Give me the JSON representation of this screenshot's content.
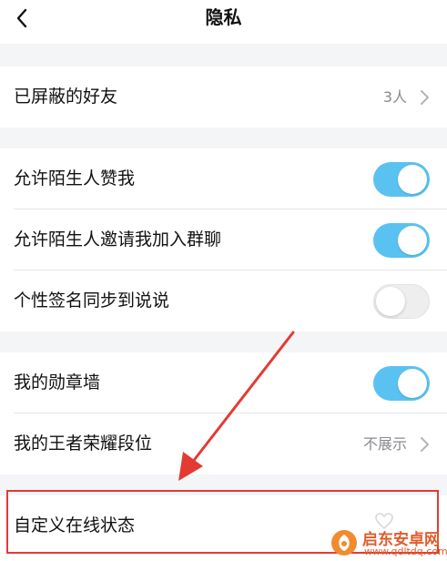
{
  "header": {
    "title": "隐私",
    "back_icon": "chevron-left-icon"
  },
  "blocked": {
    "label": "已屏蔽的好友",
    "value": "3人"
  },
  "stranger": {
    "like_label": "允许陌生人赞我",
    "like_on": true,
    "invite_label": "允许陌生人邀请我加入群聊",
    "invite_on": true,
    "signature_label": "个性签名同步到说说",
    "signature_on": false
  },
  "profile": {
    "medal_label": "我的勋章墙",
    "medal_on": true,
    "rank_label": "我的王者荣耀段位",
    "rank_value": "不展示"
  },
  "online_status": {
    "label": "自定义在线状态"
  },
  "annotation": {
    "color": "#e33b32"
  },
  "watermark": {
    "name": "启东安卓网",
    "url": "www.qdltdq.com"
  },
  "colors": {
    "toggle_on": "#5ac2f0",
    "background": "#f4f5f7"
  }
}
